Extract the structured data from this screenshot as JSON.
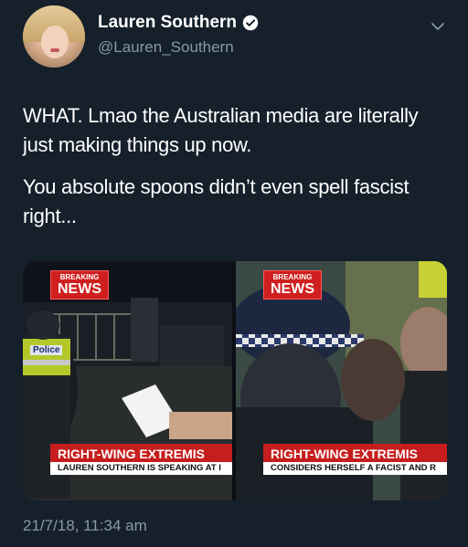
{
  "tweet": {
    "author_name": "Lauren Southern",
    "author_handle": "@Lauren_Southern",
    "paragraphs": [
      "WHAT. Lmao the Australian media are literally just making things up now.",
      "You absolute spoons didn’t even spell fascist right..."
    ],
    "timestamp": "21/7/18, 11:34 am"
  },
  "media": {
    "left": {
      "logo_top": "BREAKING",
      "logo_bottom": "NEWS",
      "badge_text": "Police",
      "headline": "RIGHT-WING EXTREMIS",
      "subline": "LAUREN SOUTHERN IS SPEAKING AT I"
    },
    "right": {
      "logo_top": "BREAKING",
      "logo_bottom": "NEWS",
      "headline": "RIGHT-WING EXTREMIS",
      "subline": "CONSIDERS HERSELF A FACIST AND R"
    }
  },
  "icons": {
    "verified": "verified-badge-icon",
    "menu": "chevron-down-icon"
  },
  "colors": {
    "background": "#15202b",
    "secondary_text": "#8899a6",
    "news_red": "#c61e1e"
  }
}
